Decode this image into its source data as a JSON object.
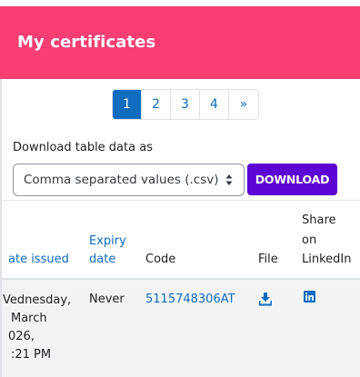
{
  "header": {
    "title": "My certificates",
    "bg_color": "#f93e73"
  },
  "pagination": {
    "pages": [
      "1",
      "2",
      "3",
      "4"
    ],
    "next": "»",
    "active": "1"
  },
  "download": {
    "label": "Download table data as",
    "format_selected": "Comma separated values (.csv)",
    "button_label": "DOWNLOAD",
    "button_color": "#5c04d4"
  },
  "table": {
    "headers": {
      "date_issued": "ate issued",
      "expiry_line1": "Expiry",
      "expiry_line2": "date",
      "code": "Code",
      "file": "File",
      "share_line1": "Share",
      "share_line2": "on",
      "share_line3": "LinkedIn"
    },
    "row": {
      "date_line1": "Vednesday,",
      "date_line2": "March",
      "date_line3": "026,",
      "date_line4": ":21 PM",
      "expiry": "Never",
      "code": "5115748306AT",
      "file_icon": "download-icon",
      "share_icon": "linkedin-icon"
    }
  },
  "accent_color": "#0f6cbf"
}
